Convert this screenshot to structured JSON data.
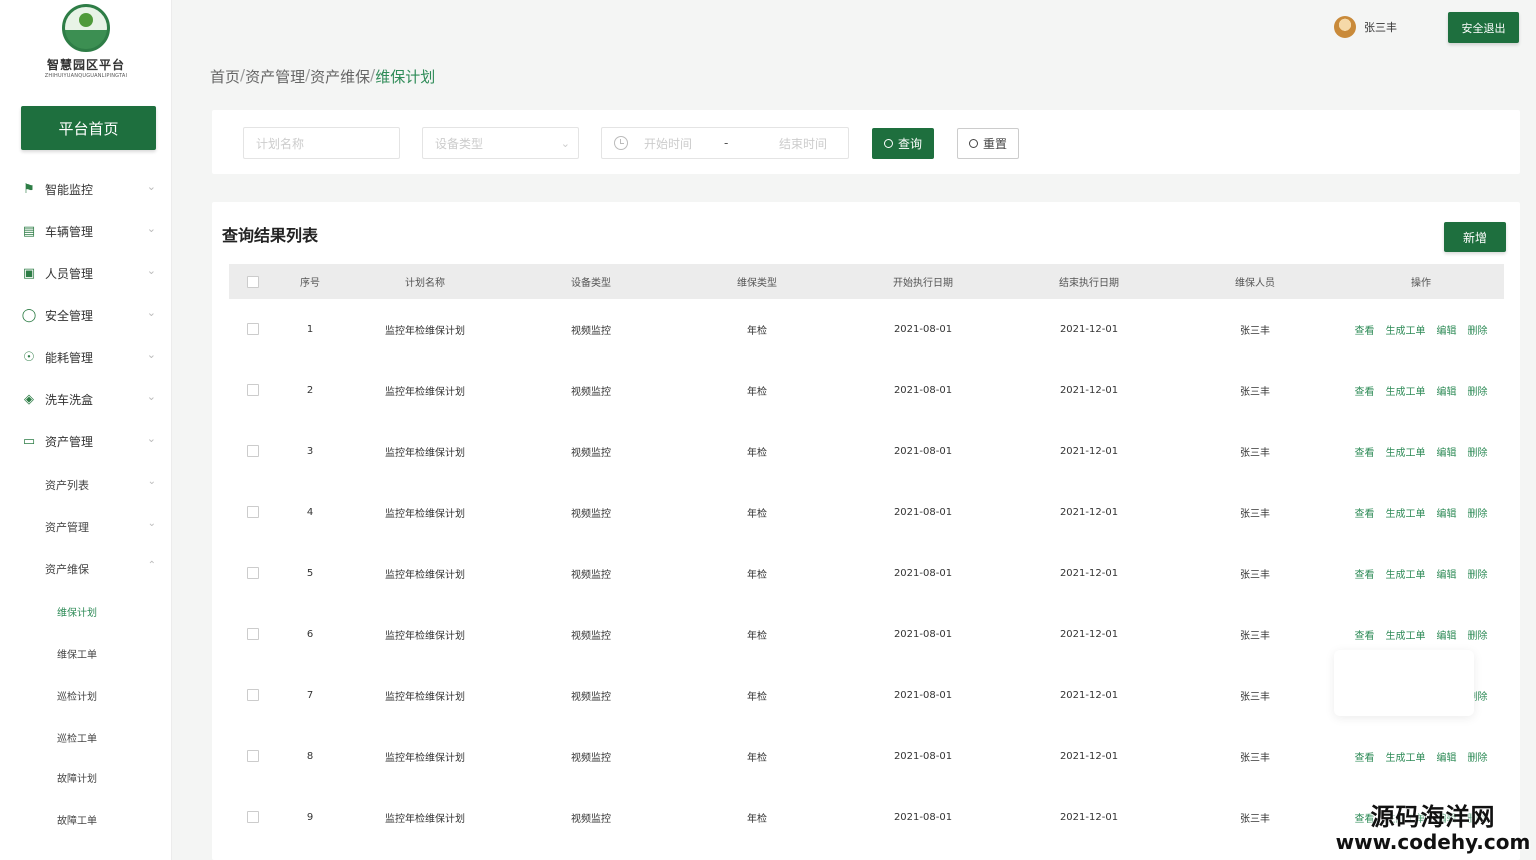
{
  "brand": {
    "title": "智慧园区平台",
    "subtitle": "ZHIHUIYUANQUGUANLIPINGTAI"
  },
  "sidebar": {
    "home_label": "平台首页",
    "menu": [
      {
        "label": "智能监控",
        "icon": "camera-icon"
      },
      {
        "label": "车辆管理",
        "icon": "vehicle-icon"
      },
      {
        "label": "人员管理",
        "icon": "people-icon"
      },
      {
        "label": "安全管理",
        "icon": "shield-icon"
      },
      {
        "label": "能耗管理",
        "icon": "energy-icon"
      },
      {
        "label": "洗车洗盒",
        "icon": "wash-icon"
      },
      {
        "label": "资产管理",
        "icon": "monitor-icon"
      }
    ],
    "sub_menu": [
      "资产列表",
      "资产管理",
      "资产维保"
    ],
    "leaf_menu": [
      "维保计划",
      "维保工单",
      "巡检计划",
      "巡检工单",
      "故障计划",
      "故障工单"
    ]
  },
  "header": {
    "user_name": "张三丰",
    "logout_label": "安全退出"
  },
  "breadcrumb": {
    "items": [
      "首页",
      "资产管理",
      "资产维保",
      "维保计划"
    ],
    "separator": "/"
  },
  "filters": {
    "plan_name_placeholder": "计划名称",
    "device_type_placeholder": "设备类型",
    "start_placeholder": "开始时间",
    "range_sep": "-",
    "end_placeholder": "结束时间",
    "query_label": "查询",
    "reset_label": "重置"
  },
  "results": {
    "title": "查询结果列表",
    "add_label": "新增",
    "columns": [
      "序号",
      "计划名称",
      "设备类型",
      "维保类型",
      "开始执行日期",
      "结束执行日期",
      "维保人员",
      "操作"
    ],
    "actions": [
      "查看",
      "生成工单",
      "编辑",
      "删除"
    ],
    "rows": [
      {
        "no": "1",
        "name": "监控年检维保计划",
        "device": "视频监控",
        "type": "年检",
        "start": "2021-08-01",
        "end": "2021-12-01",
        "person": "张三丰"
      },
      {
        "no": "2",
        "name": "监控年检维保计划",
        "device": "视频监控",
        "type": "年检",
        "start": "2021-08-01",
        "end": "2021-12-01",
        "person": "张三丰"
      },
      {
        "no": "3",
        "name": "监控年检维保计划",
        "device": "视频监控",
        "type": "年检",
        "start": "2021-08-01",
        "end": "2021-12-01",
        "person": "张三丰"
      },
      {
        "no": "4",
        "name": "监控年检维保计划",
        "device": "视频监控",
        "type": "年检",
        "start": "2021-08-01",
        "end": "2021-12-01",
        "person": "张三丰"
      },
      {
        "no": "5",
        "name": "监控年检维保计划",
        "device": "视频监控",
        "type": "年检",
        "start": "2021-08-01",
        "end": "2021-12-01",
        "person": "张三丰"
      },
      {
        "no": "6",
        "name": "监控年检维保计划",
        "device": "视频监控",
        "type": "年检",
        "start": "2021-08-01",
        "end": "2021-12-01",
        "person": "张三丰"
      },
      {
        "no": "7",
        "name": "监控年检维保计划",
        "device": "视频监控",
        "type": "年检",
        "start": "2021-08-01",
        "end": "2021-12-01",
        "person": "张三丰"
      },
      {
        "no": "8",
        "name": "监控年检维保计划",
        "device": "视频监控",
        "type": "年检",
        "start": "2021-08-01",
        "end": "2021-12-01",
        "person": "张三丰"
      },
      {
        "no": "9",
        "name": "监控年检维保计划",
        "device": "视频监控",
        "type": "年检",
        "start": "2021-08-01",
        "end": "2021-12-01",
        "person": "张三丰"
      }
    ]
  },
  "watermark": {
    "line1": "源码海洋网",
    "line2": "www.codehy.com"
  },
  "colors": {
    "primary": "#1e6f3e",
    "link": "#2e8b57",
    "background": "#f4f5f4"
  }
}
